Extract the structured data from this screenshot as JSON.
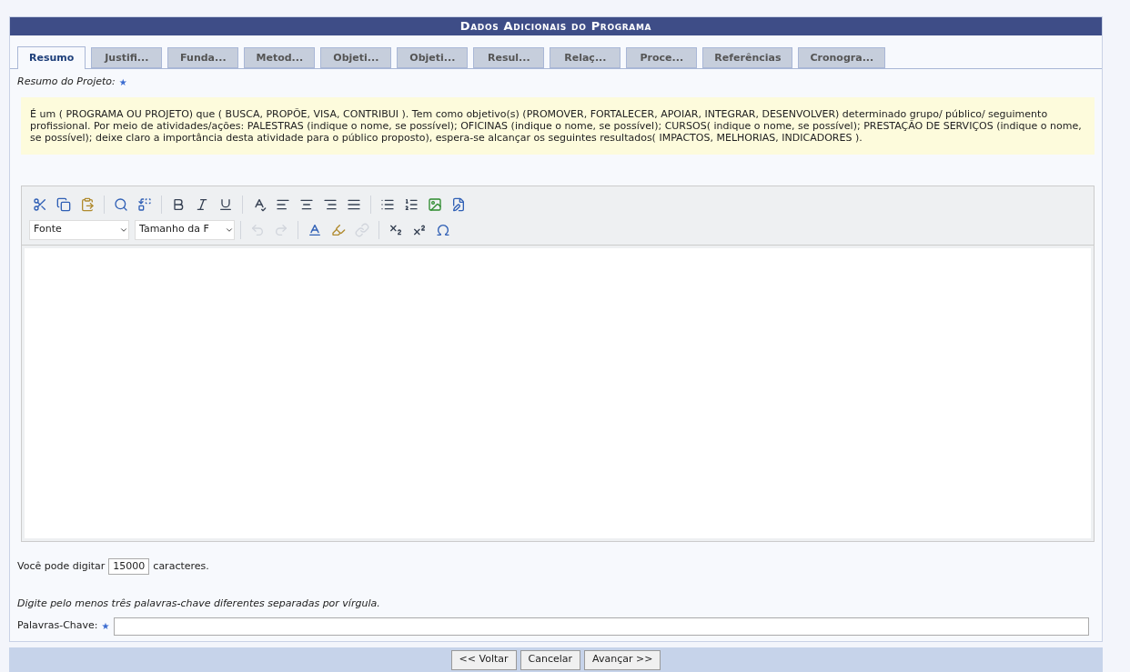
{
  "panel": {
    "title": "Dados Adicionais do Programa"
  },
  "tabs": [
    {
      "label": "Resumo",
      "selected": true
    },
    {
      "label": "Justifi...",
      "selected": false
    },
    {
      "label": "Funda...",
      "selected": false
    },
    {
      "label": "Metod...",
      "selected": false
    },
    {
      "label": "Objeti...",
      "selected": false
    },
    {
      "label": "Objeti...",
      "selected": false
    },
    {
      "label": "Resul...",
      "selected": false
    },
    {
      "label": "Relaç...",
      "selected": false
    },
    {
      "label": "Proce...",
      "selected": false
    },
    {
      "label": "Referências",
      "selected": false
    },
    {
      "label": "Cronogra...",
      "selected": false
    }
  ],
  "field_label": "Resumo do Projeto:",
  "required_mark": "★",
  "guidance": "É um ( PROGRAMA OU PROJETO) que ( BUSCA, PROPÕE, VISA, CONTRIBUI ). Tem como objetivo(s) (PROMOVER, FORTALECER, APOIAR, INTEGRAR, DESENVOLVER) determinado grupo/ público/ seguimento profissional. Por meio de atividades/ações: PALESTRAS (indique o nome, se possível); OFICINAS (indique o nome, se possível); CURSOS( indique o nome, se possível); PRESTAÇÃO DE SERVIÇOS (indique o nome, se possível); deixe claro a importância desta atividade para o público proposto), espera-se alcançar os seguintes resultados( IMPACTOS, MELHORIAS, INDICADORES ).",
  "editor": {
    "font_select": "Fonte",
    "size_select": "Tamanho da F"
  },
  "counter": {
    "before": "Você pode digitar",
    "value": "15000",
    "after": "caracteres."
  },
  "keywords": {
    "hint": "Digite pelo menos três palavras-chave diferentes separadas por vírgula.",
    "label": "Palavras-Chave:",
    "required_mark": "★"
  },
  "buttons": [
    "<< Voltar",
    "Cancelar",
    "Avançar >>"
  ]
}
